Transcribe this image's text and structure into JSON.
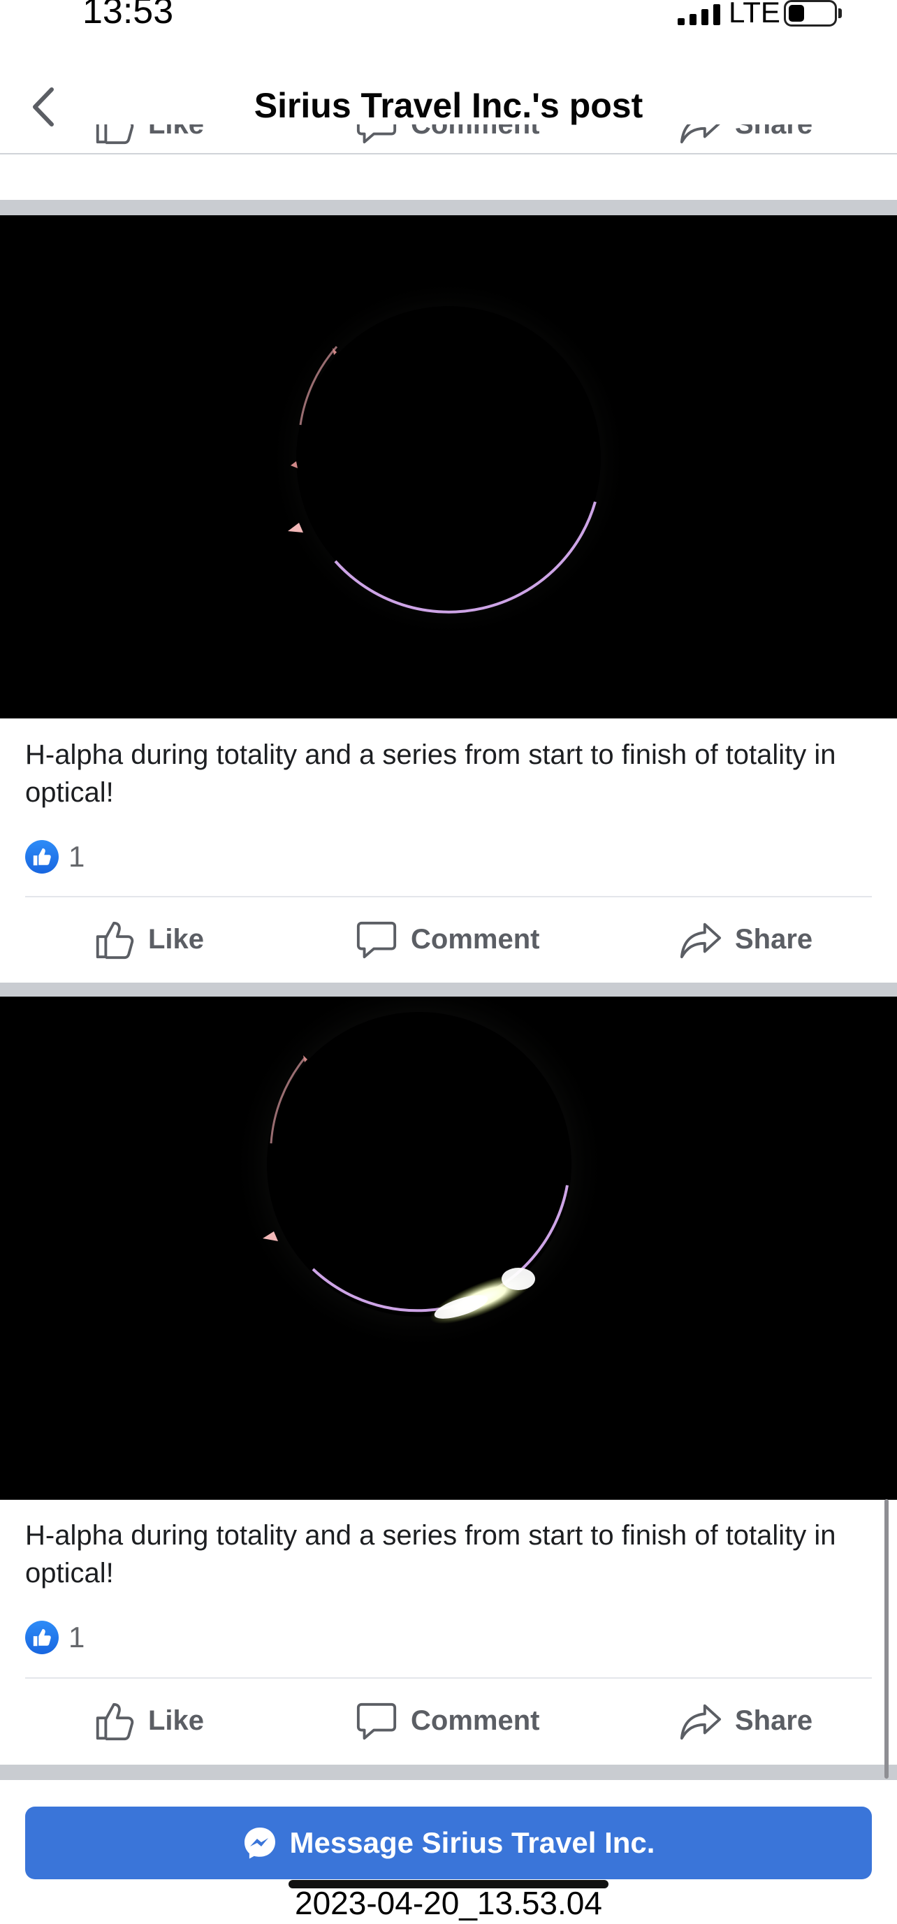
{
  "status_bar": {
    "time": "13:53",
    "network": "LTE"
  },
  "header": {
    "title": "Sirius Travel Inc.'s post"
  },
  "actions": {
    "like": "Like",
    "comment": "Comment",
    "share": "Share"
  },
  "posts": [
    {
      "caption": "H-alpha during totality and a series from start to finish of totality in optical!",
      "reaction_count": "1"
    },
    {
      "caption": "H-alpha during totality and a series from start to finish of totality in optical!",
      "reaction_count": "1"
    }
  ],
  "message_button": {
    "label": "Message Sirius Travel Inc."
  },
  "screenshot_timestamp": "2023-04-20_13.53.04",
  "colors": {
    "accent": "#3a75d9",
    "like_badge": "#1877f2",
    "separator": "#c9ccd1"
  }
}
